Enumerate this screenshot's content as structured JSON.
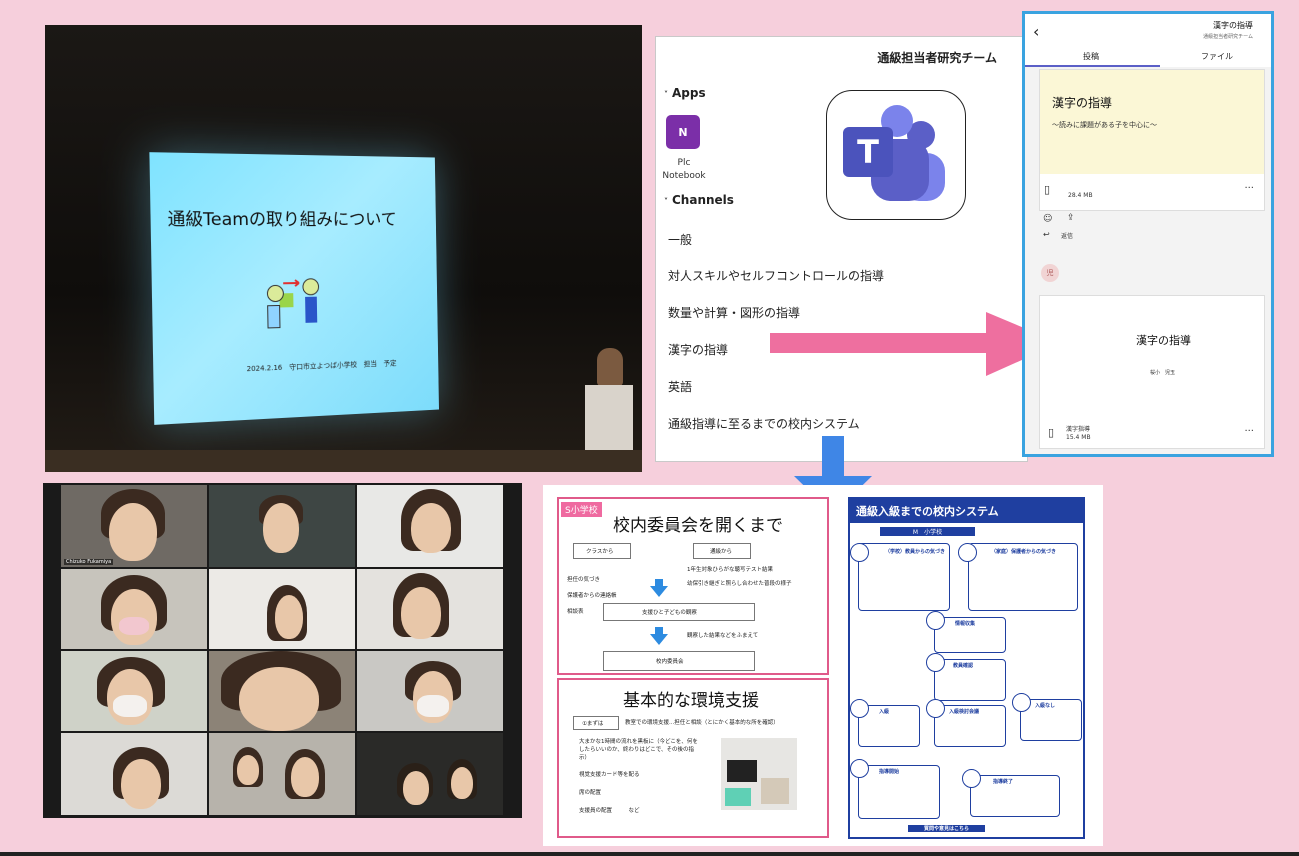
{
  "presentation": {
    "slide_title": "通級Teamの取り組みについて",
    "slide_date_line": "2024.2.16　守口市立よつば小学校　担当　予定"
  },
  "teams_panel": {
    "team_name": "通級担当者研究チーム",
    "apps_heading": "Apps",
    "app": {
      "icon": "onenote-icon",
      "icon_text": "N",
      "label": "Plc Notebook",
      "color": "#7b2fa8"
    },
    "channels_heading": "Channels",
    "channels": [
      "一般",
      "対人スキルやセルフコントロールの指導",
      "数量や計算・図形の指導",
      "漢字の指導",
      "英語",
      "通級指導に至るまでの校内システム"
    ],
    "logo": {
      "icon": "teams-logo",
      "letter": "T"
    }
  },
  "mobile": {
    "back_icon": "chevron-left-icon",
    "title": "漢字の指導",
    "subtitle": "通級担当者研究チーム",
    "tabs": [
      "投稿",
      "ファイル"
    ],
    "post1": {
      "title": "漢字の指導",
      "subtitle": "〜読みに課題がある子を中心に〜",
      "file_size": "28.4 MB",
      "reply": "返信"
    },
    "avatar": "児",
    "post2": {
      "title": "漢字の指導",
      "author": "桜小　児玉",
      "file_name": "漢字指導",
      "file_size": "15.4 MB"
    }
  },
  "zoom": {
    "participants": [
      "Chizuko Fukamiya",
      "",
      "",
      "",
      "",
      "",
      "",
      "",
      "",
      "",
      "",
      ""
    ]
  },
  "slide": {
    "badge": "S小学校",
    "title1": "校内委員会を開くまで",
    "from_class": "クラスから",
    "from_tsukyu": "通級から",
    "left_items": [
      "担任の気づき",
      "保護者からの連絡帳",
      "相談表"
    ],
    "right_items": [
      "1年生対象ひらがな聴写テスト結果",
      "幼保引き継ぎと照らし合わせた普段の様子"
    ],
    "support_box": "支援ひと子どもの観察",
    "after_obs": "観察した結果などをふまえて",
    "committee_box": "校内委員会",
    "title2": "基本的な環境支援",
    "step_label": "①まずは",
    "step_text": "教室での環境支援...担任と相談（とにかく基本的な所を確認）",
    "bullets2": [
      "大まかな1時間の流れを黒板に（今どこを、何をしたらいいのか、終わりはどこで、その後の指示）",
      "視覚支援カード等を配る",
      "席の配置",
      "支援員の配置　　　など"
    ],
    "flow_title": "通級入級までの校内システム",
    "flow_school": "M　小学校",
    "flow_nodes": [
      "（学校）教員からの気づき",
      "（家庭）保護者からの気づき",
      "情報収集",
      "教員確認",
      "入級なし",
      "入級検討会議",
      "入級",
      "指導開始",
      "指導終了"
    ],
    "flow_footer": "質問や意見はこちら"
  },
  "colors": {
    "background": "#f6cfdc",
    "arrow_pink": "#ee6f9f",
    "arrow_blue": "#3f86e6",
    "teams_purple": "#5b5fc7",
    "flow_blue": "#1f3fa0"
  }
}
